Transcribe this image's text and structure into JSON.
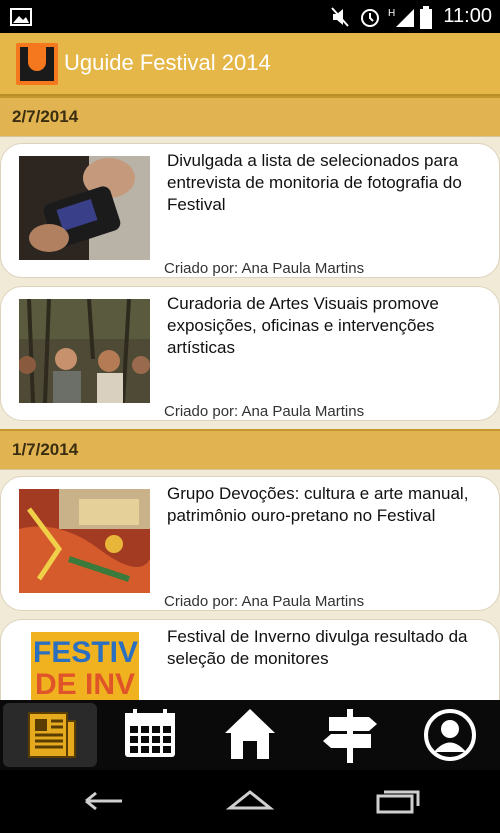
{
  "status_bar": {
    "time": "11:00",
    "icons": [
      "image-icon",
      "mute-icon",
      "alarm-icon",
      "signal-icon",
      "battery-icon"
    ]
  },
  "app": {
    "title": "Uguide Festival 2014",
    "logo_letter": "U",
    "colors": {
      "appbar": "#e5b648",
      "logo": "#f5781f",
      "background": "#f0ead7"
    }
  },
  "feed": {
    "groups": [
      {
        "date": "2/7/2014",
        "items": [
          {
            "title": "Divulgada a lista de selecionados para entrevista de monitoria de fotografia do Festival",
            "author": "Criado por: Ana Paula Martins",
            "thumb": "camera-photo"
          },
          {
            "title": "Curadoria de Artes Visuais promove exposições, oficinas e intervenções artísticas",
            "author": "Criado por: Ana Paula Martins",
            "thumb": "people-photo"
          }
        ]
      },
      {
        "date": "1/7/2014",
        "items": [
          {
            "title": "Grupo Devoções: cultura e arte manual, patrimônio ouro-pretano no Festival",
            "author": "Criado por: Ana Paula Martins",
            "thumb": "fabric-photo"
          },
          {
            "title": "Festival de Inverno divulga resultado da seleção de monitores",
            "author": "",
            "thumb": "festival-poster"
          }
        ]
      }
    ]
  },
  "bottom_nav": {
    "items": [
      {
        "icon": "news-icon",
        "active": true
      },
      {
        "icon": "calendar-icon",
        "active": false
      },
      {
        "icon": "home-icon",
        "active": false
      },
      {
        "icon": "signpost-icon",
        "active": false
      },
      {
        "icon": "profile-icon",
        "active": false
      }
    ]
  },
  "system_nav": {
    "buttons": [
      "back-icon",
      "home-button-icon",
      "recent-apps-icon"
    ]
  }
}
